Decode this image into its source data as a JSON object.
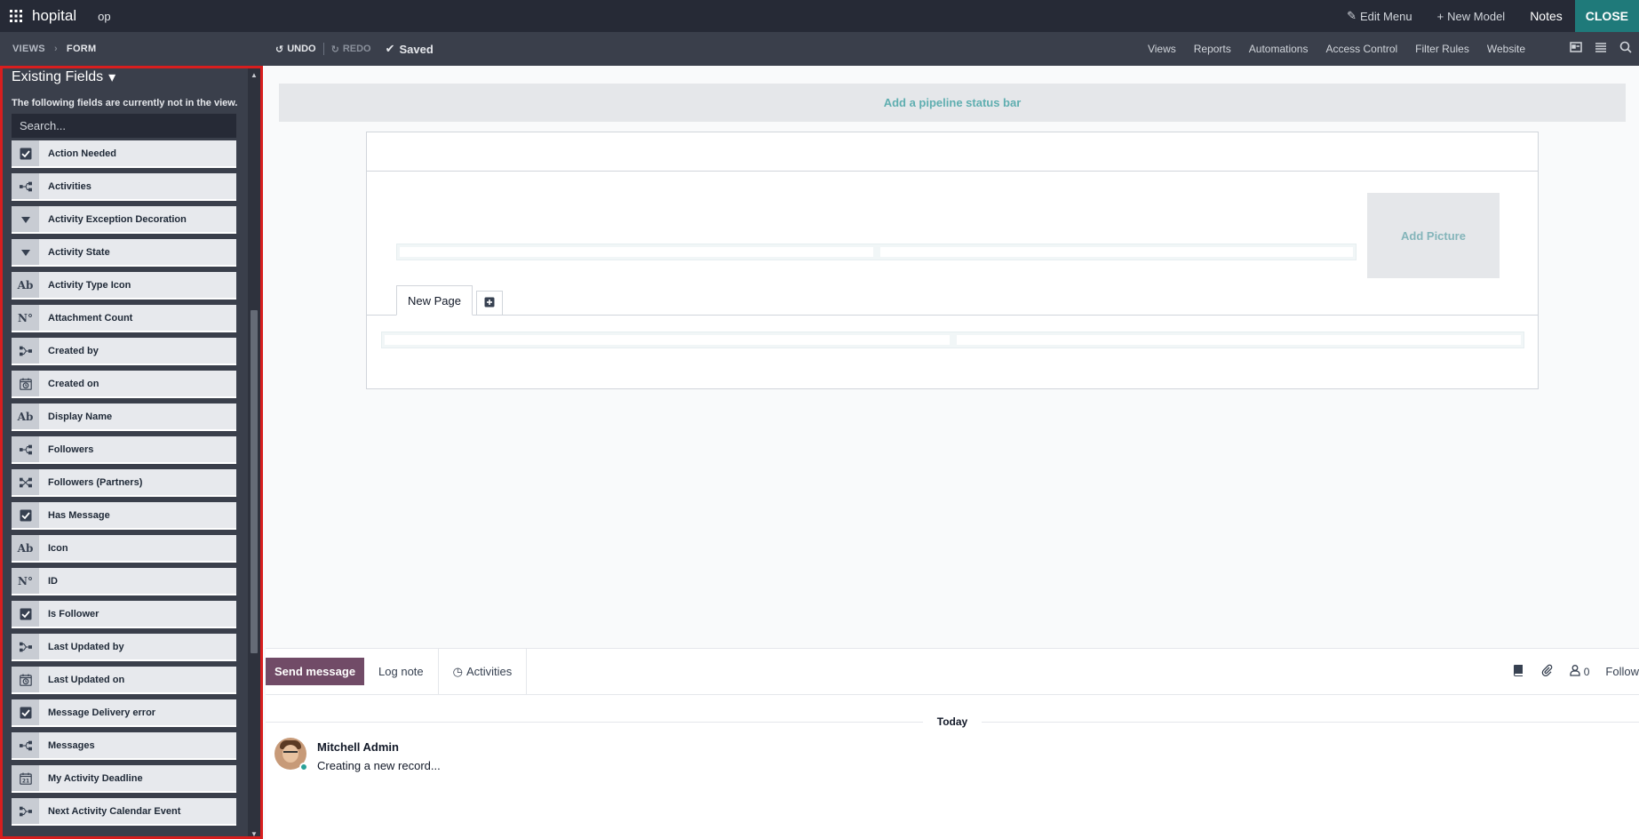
{
  "topbar": {
    "app_name": "hopital",
    "menu_item": "op",
    "edit_menu": "Edit Menu",
    "new_model": "New Model",
    "notes": "Notes",
    "close": "CLOSE"
  },
  "subbar": {
    "views": "VIEWS",
    "form": "FORM",
    "undo": "UNDO",
    "redo": "REDO",
    "saved": "Saved",
    "nav": [
      "Views",
      "Reports",
      "Automations",
      "Access Control",
      "Filter Rules",
      "Website"
    ]
  },
  "sidebar": {
    "title": "Existing Fields",
    "description": "The following fields are currently not in the view.",
    "search_placeholder": "Search...",
    "fields": [
      {
        "label": "Action Needed",
        "icon": "checkbox-icon"
      },
      {
        "label": "Activities",
        "icon": "one2many-icon"
      },
      {
        "label": "Activity Exception Decoration",
        "icon": "selection-icon"
      },
      {
        "label": "Activity State",
        "icon": "selection-icon"
      },
      {
        "label": "Activity Type Icon",
        "icon": "char-icon"
      },
      {
        "label": "Attachment Count",
        "icon": "integer-icon"
      },
      {
        "label": "Created by",
        "icon": "many2one-icon"
      },
      {
        "label": "Created on",
        "icon": "datetime-icon"
      },
      {
        "label": "Display Name",
        "icon": "char-icon"
      },
      {
        "label": "Followers",
        "icon": "one2many-icon"
      },
      {
        "label": "Followers (Partners)",
        "icon": "many2many-icon"
      },
      {
        "label": "Has Message",
        "icon": "checkbox-icon"
      },
      {
        "label": "Icon",
        "icon": "char-icon"
      },
      {
        "label": "ID",
        "icon": "integer-icon"
      },
      {
        "label": "Is Follower",
        "icon": "checkbox-icon"
      },
      {
        "label": "Last Updated by",
        "icon": "many2one-icon"
      },
      {
        "label": "Last Updated on",
        "icon": "datetime-icon"
      },
      {
        "label": "Message Delivery error",
        "icon": "checkbox-icon"
      },
      {
        "label": "Messages",
        "icon": "one2many-icon"
      },
      {
        "label": "My Activity Deadline",
        "icon": "date-icon"
      },
      {
        "label": "Next Activity Calendar Event",
        "icon": "many2one-icon"
      }
    ]
  },
  "form": {
    "pipeline": "Add a pipeline status bar",
    "add_picture": "Add Picture",
    "tab_label": "New Page"
  },
  "chatter": {
    "send_message": "Send message",
    "log_note": "Log note",
    "activities": "Activities",
    "follower_count": "0",
    "follow": "Follow",
    "today": "Today",
    "author": "Mitchell Admin",
    "message": "Creating a new record..."
  },
  "colors": {
    "topbar": "#262a36",
    "sidebar": "#3a3f4b",
    "close_button": "#1f7a7a",
    "send_button": "#714b67",
    "highlight_border": "#d81e1e"
  }
}
